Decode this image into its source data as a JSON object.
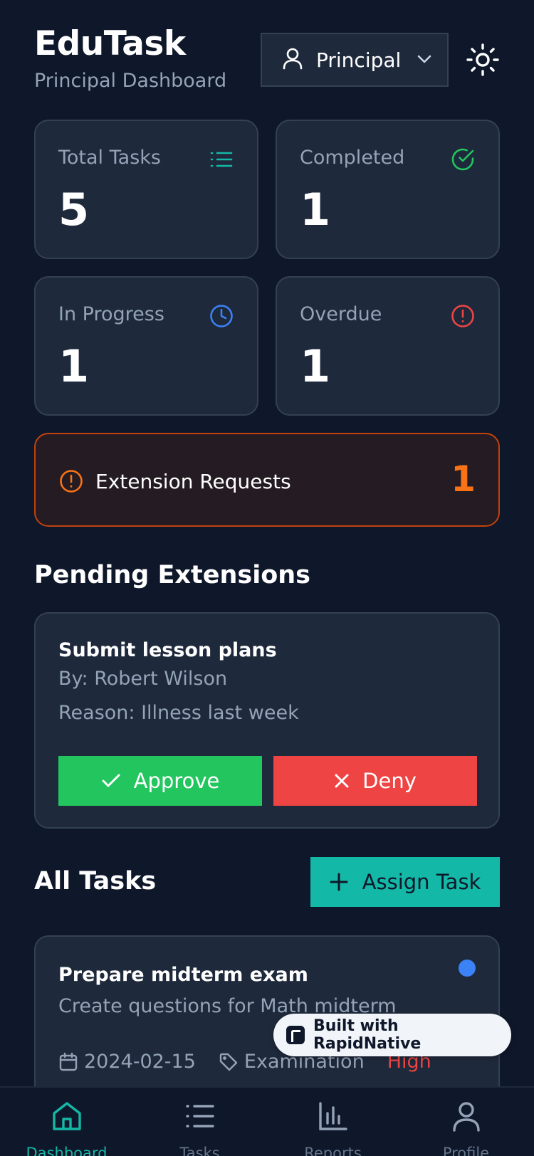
{
  "header": {
    "app_title": "EduTask",
    "subtitle": "Principal Dashboard",
    "role_label": "Principal"
  },
  "stats": [
    {
      "label": "Total Tasks",
      "value": "5",
      "icon": "list-icon",
      "color": "#14b8a6"
    },
    {
      "label": "Completed",
      "value": "1",
      "icon": "check-circle-icon",
      "color": "#22c55e"
    },
    {
      "label": "In Progress",
      "value": "1",
      "icon": "clock-icon",
      "color": "#3b82f6"
    },
    {
      "label": "Overdue",
      "value": "1",
      "icon": "alert-circle-icon",
      "color": "#ef4444"
    }
  ],
  "extension_banner": {
    "label": "Extension Requests",
    "count": "1",
    "color": "#f97316"
  },
  "pending": {
    "section_title": "Pending Extensions",
    "task_title": "Submit lesson plans",
    "by": "By: Robert Wilson",
    "reason": "Reason: Illness last week",
    "approve_label": "Approve",
    "deny_label": "Deny"
  },
  "all_tasks": {
    "section_title": "All Tasks",
    "assign_label": "Assign Task",
    "tasks": [
      {
        "title": "Prepare midterm exam",
        "description": "Create questions for Math midterm",
        "date": "2024-02-15",
        "category": "Examination",
        "priority": "High",
        "status_color": "#3b82f6"
      }
    ]
  },
  "badge": {
    "text": "Built with RapidNative"
  },
  "bottom_nav": [
    {
      "label": "Dashboard",
      "icon": "home-icon",
      "active": true
    },
    {
      "label": "Tasks",
      "icon": "list-icon",
      "active": false
    },
    {
      "label": "Reports",
      "icon": "bar-chart-icon",
      "active": false
    },
    {
      "label": "Profile",
      "icon": "user-icon",
      "active": false
    }
  ],
  "colors": {
    "background": "#0f172a",
    "card": "#1e293b",
    "accent": "#14b8a6"
  }
}
